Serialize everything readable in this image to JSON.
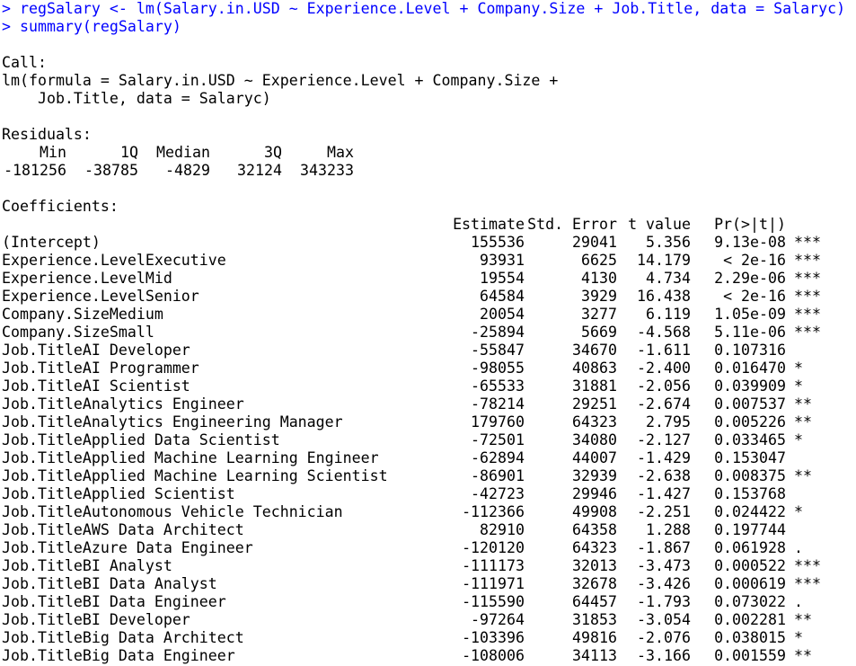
{
  "console": {
    "commands": [
      "> regSalary <- lm(Salary.in.USD ~ Experience.Level + Company.Size + Job.Title, data = Salaryc)",
      "> summary(regSalary)"
    ],
    "call_label": "Call:",
    "call_lines": [
      "lm(formula = Salary.in.USD ~ Experience.Level + Company.Size +",
      "    Job.Title, data = Salaryc)"
    ],
    "residuals_label": "Residuals:",
    "residuals_headers": [
      "Min",
      "1Q",
      "Median",
      "3Q",
      "Max"
    ],
    "residuals_values": [
      "-181256",
      "-38785",
      "-4829",
      "32124",
      "343233"
    ],
    "coefficients_label": "Coefficients:",
    "coef_headers": {
      "estimate": "Estimate",
      "std_error": "Std. Error",
      "t_value": "t value",
      "p_value": "Pr(>|t|)"
    },
    "coefficients": [
      {
        "name": "(Intercept)",
        "estimate": "155536",
        "std_error": "29041",
        "t_value": "5.356",
        "p_value": "9.13e-08",
        "sig": "***"
      },
      {
        "name": "Experience.LevelExecutive",
        "estimate": "93931",
        "std_error": "6625",
        "t_value": "14.179",
        "p_value": "< 2e-16",
        "sig": "***"
      },
      {
        "name": "Experience.LevelMid",
        "estimate": "19554",
        "std_error": "4130",
        "t_value": "4.734",
        "p_value": "2.29e-06",
        "sig": "***"
      },
      {
        "name": "Experience.LevelSenior",
        "estimate": "64584",
        "std_error": "3929",
        "t_value": "16.438",
        "p_value": "< 2e-16",
        "sig": "***"
      },
      {
        "name": "Company.SizeMedium",
        "estimate": "20054",
        "std_error": "3277",
        "t_value": "6.119",
        "p_value": "1.05e-09",
        "sig": "***"
      },
      {
        "name": "Company.SizeSmall",
        "estimate": "-25894",
        "std_error": "5669",
        "t_value": "-4.568",
        "p_value": "5.11e-06",
        "sig": "***"
      },
      {
        "name": "Job.TitleAI Developer",
        "estimate": "-55847",
        "std_error": "34670",
        "t_value": "-1.611",
        "p_value": "0.107316",
        "sig": ""
      },
      {
        "name": "Job.TitleAI Programmer",
        "estimate": "-98055",
        "std_error": "40863",
        "t_value": "-2.400",
        "p_value": "0.016470",
        "sig": "*"
      },
      {
        "name": "Job.TitleAI Scientist",
        "estimate": "-65533",
        "std_error": "31881",
        "t_value": "-2.056",
        "p_value": "0.039909",
        "sig": "*"
      },
      {
        "name": "Job.TitleAnalytics Engineer",
        "estimate": "-78214",
        "std_error": "29251",
        "t_value": "-2.674",
        "p_value": "0.007537",
        "sig": "**"
      },
      {
        "name": "Job.TitleAnalytics Engineering Manager",
        "estimate": "179760",
        "std_error": "64323",
        "t_value": "2.795",
        "p_value": "0.005226",
        "sig": "**"
      },
      {
        "name": "Job.TitleApplied Data Scientist",
        "estimate": "-72501",
        "std_error": "34080",
        "t_value": "-2.127",
        "p_value": "0.033465",
        "sig": "*"
      },
      {
        "name": "Job.TitleApplied Machine Learning Engineer",
        "estimate": "-62894",
        "std_error": "44007",
        "t_value": "-1.429",
        "p_value": "0.153047",
        "sig": ""
      },
      {
        "name": "Job.TitleApplied Machine Learning Scientist",
        "estimate": "-86901",
        "std_error": "32939",
        "t_value": "-2.638",
        "p_value": "0.008375",
        "sig": "**"
      },
      {
        "name": "Job.TitleApplied Scientist",
        "estimate": "-42723",
        "std_error": "29946",
        "t_value": "-1.427",
        "p_value": "0.153768",
        "sig": ""
      },
      {
        "name": "Job.TitleAutonomous Vehicle Technician",
        "estimate": "-112366",
        "std_error": "49908",
        "t_value": "-2.251",
        "p_value": "0.024422",
        "sig": "*"
      },
      {
        "name": "Job.TitleAWS Data Architect",
        "estimate": "82910",
        "std_error": "64358",
        "t_value": "1.288",
        "p_value": "0.197744",
        "sig": ""
      },
      {
        "name": "Job.TitleAzure Data Engineer",
        "estimate": "-120120",
        "std_error": "64323",
        "t_value": "-1.867",
        "p_value": "0.061928",
        "sig": "."
      },
      {
        "name": "Job.TitleBI Analyst",
        "estimate": "-111173",
        "std_error": "32013",
        "t_value": "-3.473",
        "p_value": "0.000522",
        "sig": "***"
      },
      {
        "name": "Job.TitleBI Data Analyst",
        "estimate": "-111971",
        "std_error": "32678",
        "t_value": "-3.426",
        "p_value": "0.000619",
        "sig": "***"
      },
      {
        "name": "Job.TitleBI Data Engineer",
        "estimate": "-115590",
        "std_error": "64457",
        "t_value": "-1.793",
        "p_value": "0.073022",
        "sig": "."
      },
      {
        "name": "Job.TitleBI Developer",
        "estimate": "-97264",
        "std_error": "31853",
        "t_value": "-3.054",
        "p_value": "0.002281",
        "sig": "**"
      },
      {
        "name": "Job.TitleBig Data Architect",
        "estimate": "-103396",
        "std_error": "49816",
        "t_value": "-2.076",
        "p_value": "0.038015",
        "sig": "*"
      },
      {
        "name": "Job.TitleBig Data Engineer",
        "estimate": "-108006",
        "std_error": "34113",
        "t_value": "-3.166",
        "p_value": "0.001559",
        "sig": "**"
      }
    ],
    "colors": {
      "command": "#0000ff",
      "output": "#000000",
      "background": "#ffffff"
    }
  }
}
